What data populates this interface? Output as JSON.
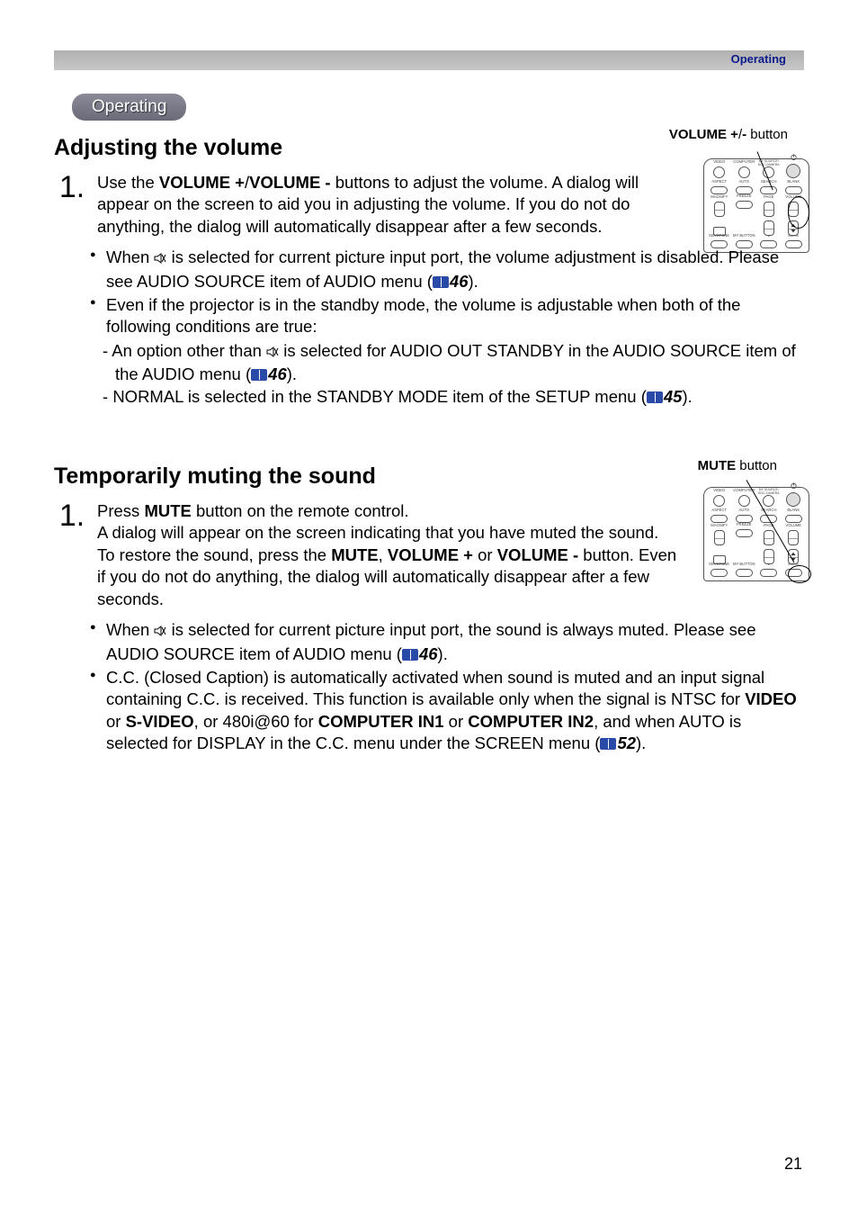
{
  "header": {
    "section_label": "Operating",
    "pill_label": "Operating"
  },
  "page_number": "21",
  "icons": {
    "mute": "mute-speaker-icon",
    "book": "book-reference-icon"
  },
  "remote_labels": {
    "row1": [
      "VIDEO",
      "COMPUTER",
      "MY SOURCE/\nDOC.CAMERA",
      ""
    ],
    "row2": [
      "ASPECT",
      "AUTO",
      "SEARCH",
      "BLANK"
    ],
    "row3_left_top": "MAGNIFY",
    "row3_left_bottom": "",
    "row3_2": "FREEZE",
    "row3_3_top": "PAGE",
    "row3_3_bottom": "",
    "row3_4_top": "VOLUME",
    "row3_4_bottom": "",
    "row4_left": "ON",
    "row4_2": "",
    "row4_3_top": "UP",
    "row4_3_bottom": "DOWN",
    "row4_4": "",
    "row5": [
      "KEYSTONE",
      "MY BUTTON",
      "",
      "MUTE"
    ],
    "row5_sub": [
      "",
      "1",
      "2",
      ""
    ]
  },
  "section1": {
    "title": "Adjusting the volume",
    "caption_prefix": "VOLUME +",
    "caption_sep": "/",
    "caption_suffix_bold": "-",
    "caption_tail": " button",
    "step_num": "1.",
    "step_text_a": "Use the ",
    "step_text_b": "VOLUME +",
    "step_text_c": "/",
    "step_text_d": "VOLUME -",
    "step_text_e": " buttons to adjust the volume. A dialog will appear on the screen to aid you in adjusting the volume. If you do not do anything, the dialog will automatically disappear after a few seconds.",
    "bullet1_a": "When ",
    "bullet1_b": " is selected for current picture input port, the volume adjustment is disabled. Please see AUDIO SOURCE item of AUDIO menu (",
    "bullet1_ref": "46",
    "bullet1_c": ").",
    "bullet2": "Even if the projector is in the standby mode, the volume is adjustable when both of the following conditions are true:",
    "sub1_a": "An option other than ",
    "sub1_b": " is selected for AUDIO OUT STANDBY in the AUDIO SOURCE item of the AUDIO menu (",
    "sub1_ref": "46",
    "sub1_c": ").",
    "sub2_a": "NORMAL is selected in the STANDBY MODE item of the SETUP menu (",
    "sub2_ref": "45",
    "sub2_c": ")."
  },
  "section2": {
    "title": "Temporarily muting the sound",
    "caption_bold": "MUTE",
    "caption_tail": " button",
    "step_num": "1.",
    "step_line1_a": "Press ",
    "step_line1_b": "MUTE",
    "step_line1_c": " button on the remote control.",
    "step_line2_a": "A dialog will appear on the screen indicating that you have muted the sound.",
    "step_line3_a": "To restore the sound, press the  ",
    "step_line3_b": "MUTE",
    "step_line3_c": ", ",
    "step_line3_d": "VOLUME +",
    "step_line3_e": " or ",
    "step_line3_f": "VOLUME -",
    "step_line3_g": " button. Even if you do not do anything, the dialog will automatically disappear after a few seconds.",
    "bullet1_a": "When ",
    "bullet1_b": " is selected for current picture input port, the sound is always muted. Please see AUDIO SOURCE item of AUDIO menu (",
    "bullet1_ref": "46",
    "bullet1_c": ").",
    "bullet2_a": "C.C. (Closed Caption) is automatically activated when sound is muted and an input signal containing C.C. is received. This function is available only when the signal is NTSC for ",
    "bullet2_b": "VIDEO",
    "bullet2_c": " or ",
    "bullet2_d": "S-VIDEO",
    "bullet2_e": ", or 480i@60 for ",
    "bullet2_f": "COMPUTER IN1",
    "bullet2_g": " or ",
    "bullet2_h": "COMPUTER IN2",
    "bullet2_i": ", and when AUTO is selected for DISPLAY in the C.C. menu under the SCREEN menu (",
    "bullet2_ref": "52",
    "bullet2_j": ")."
  }
}
